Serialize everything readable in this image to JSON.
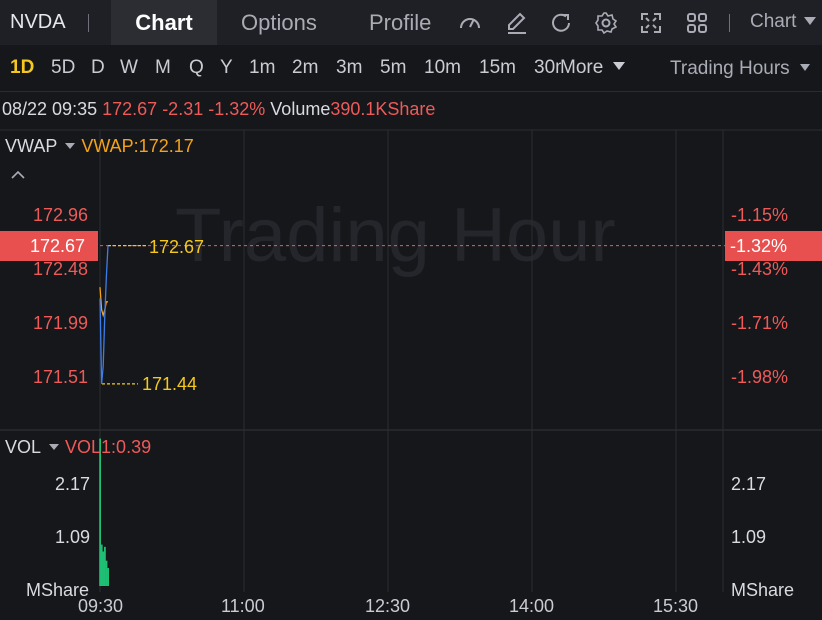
{
  "header": {
    "symbol": "NVDA",
    "tabs": [
      {
        "label": "Chart",
        "active": true
      },
      {
        "label": "Options",
        "active": false
      },
      {
        "label": "Profile",
        "active": false
      }
    ],
    "toolbar_icons": [
      "gauge-icon",
      "draw-icon",
      "refresh-icon",
      "gear-icon",
      "fullscreen-icon",
      "grid-icon"
    ],
    "chart_menu_label": "Chart"
  },
  "periods": {
    "items": [
      "1D",
      "5D",
      "D",
      "W",
      "M",
      "Q",
      "Y",
      "1m",
      "2m",
      "3m",
      "5m",
      "10m",
      "15m",
      "30m"
    ],
    "active": "1D",
    "more_label": "More",
    "session_label": "Trading Hours"
  },
  "quote": {
    "datetime": "08/22 09:35",
    "price": "172.67",
    "change": "-2.31",
    "change_pct": "-1.32%",
    "volume_label": "Volume",
    "volume_value": "390.1KShare"
  },
  "price_panel": {
    "indicator_name": "VWAP",
    "indicator_value": "VWAP:172.17",
    "watermark": "Trading Hour",
    "current_price": "172.67",
    "current_pct": "-1.32%",
    "high_label": "172.67",
    "low_label": "171.44",
    "y_left": [
      "172.96",
      "172.48",
      "171.99",
      "171.51"
    ],
    "y_right": [
      "-1.15%",
      "-1.43%",
      "-1.71%",
      "-1.98%"
    ],
    "colors": {
      "price_line": "#3d7de8",
      "vwap_line": "#f3a21a",
      "down": "#ee5a58",
      "marker": "#f4c81c"
    }
  },
  "volume_panel": {
    "indicator_name": "VOL",
    "indicator_value": "VOL1:0.39",
    "y_labels": [
      "2.17",
      "1.09",
      "MShare"
    ],
    "bar_color": "#1fbf74"
  },
  "x_axis": [
    "09:30",
    "11:00",
    "12:30",
    "14:00",
    "15:30"
  ],
  "chart_data": {
    "type": "line",
    "session_start": "09:30",
    "session_end": "16:00",
    "price_series": {
      "name": "",
      "t": [
        "09:30",
        "09:31",
        "09:32",
        "09:33",
        "09:34",
        "09:35"
      ],
      "values": [
        172.2,
        171.44,
        171.6,
        172.05,
        172.4,
        172.67
      ]
    },
    "vwap_series": {
      "name": "VWAP",
      "t": [
        "09:30",
        "09:31",
        "09:32",
        "09:33",
        "09:34",
        "09:35"
      ],
      "values": [
        172.3,
        172.1,
        172.05,
        172.1,
        172.17,
        172.17
      ]
    },
    "volume_series": {
      "name": "VOL",
      "unit": "MShare",
      "t": [
        "09:30",
        "09:31",
        "09:32",
        "09:33",
        "09:34",
        "09:35"
      ],
      "values": [
        3.2,
        0.9,
        0.75,
        0.85,
        0.55,
        0.39
      ]
    },
    "price_ylim": [
      171.2,
      173.3
    ],
    "volume_ylim": [
      0,
      3.3
    ],
    "grid": true
  }
}
